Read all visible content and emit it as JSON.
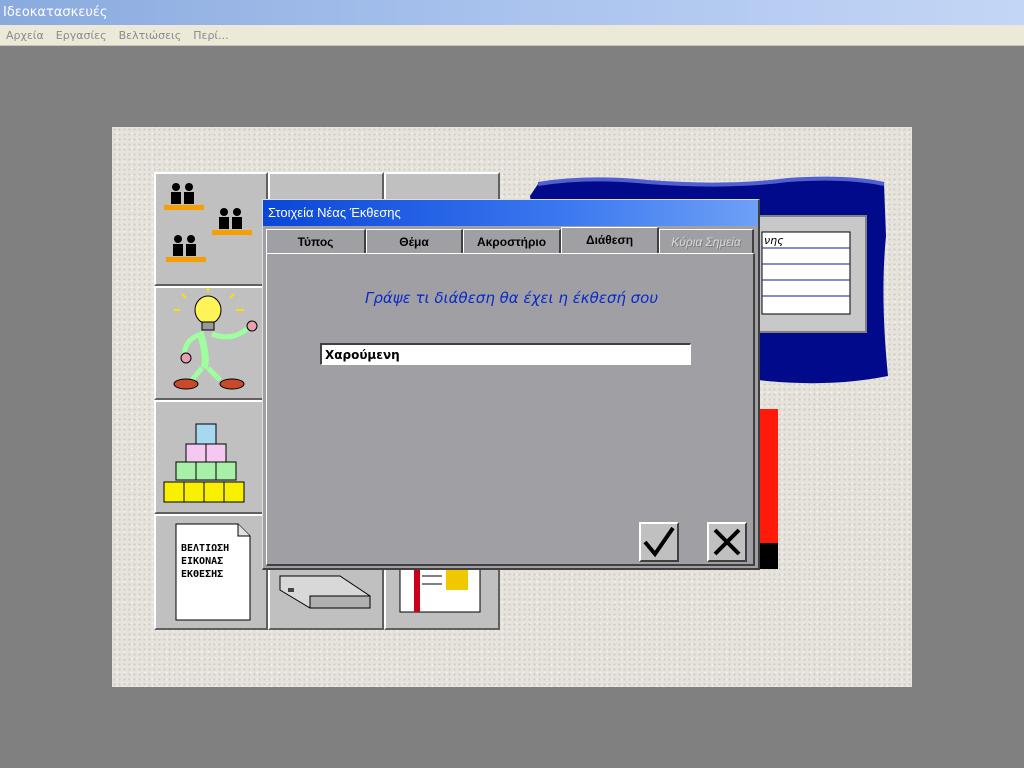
{
  "window": {
    "title": "Ιδεοκατασκευές"
  },
  "menu": [
    "Αρχεία",
    "Εργασίες",
    "Βελτιώσεις",
    "Περί..."
  ],
  "tiles": {
    "improve_doc_label": [
      "ΒΕΛΤΙΩΣΗ",
      "ΕΙΚΟΝΑΣ",
      "ΕΚΘΕΣΗΣ"
    ]
  },
  "dialog": {
    "title": "Στοιχεία Νέας Έκθεσης",
    "tabs": [
      {
        "label": "Τύπος"
      },
      {
        "label": "Θέμα"
      },
      {
        "label": "Ακροστήριο"
      },
      {
        "label": "Διάθεση"
      },
      {
        "label": "Κύρια Σημεία"
      }
    ],
    "active_tab": "Διάθεση",
    "prompt": "Γράψε τι διάθεση θα έχει η έκθεσή σου",
    "field_value": "Χαρούμενη"
  },
  "background_partial_text": "νης",
  "colors": {
    "dialog_title": "#0a46d8",
    "prompt": "#0a2ac8",
    "frame_blue": "#000a8a",
    "red_block": "#ff1a0a"
  }
}
